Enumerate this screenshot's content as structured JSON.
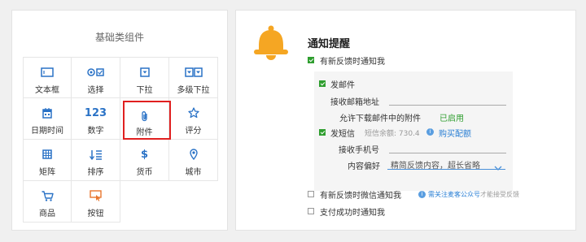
{
  "left": {
    "title": "基础类组件",
    "items": [
      {
        "label": "文本框",
        "icon": "textbox-icon"
      },
      {
        "label": "选择",
        "icon": "select-icon"
      },
      {
        "label": "下拉",
        "icon": "dropdown-icon"
      },
      {
        "label": "多级下拉",
        "icon": "multi-dropdown-icon"
      },
      {
        "label": "日期时间",
        "icon": "calendar-icon"
      },
      {
        "label": "数字",
        "icon": "number-icon",
        "glyph": "123"
      },
      {
        "label": "附件",
        "icon": "paperclip-icon",
        "selected": true
      },
      {
        "label": "评分",
        "icon": "star-icon"
      },
      {
        "label": "矩阵",
        "icon": "matrix-icon"
      },
      {
        "label": "排序",
        "icon": "sort-icon"
      },
      {
        "label": "货币",
        "icon": "currency-icon",
        "glyph": "$"
      },
      {
        "label": "城市",
        "icon": "location-icon"
      },
      {
        "label": "商品",
        "icon": "cart-icon"
      },
      {
        "label": "按钮",
        "icon": "button-cursor-icon"
      }
    ],
    "accent": "#2a72c6",
    "highlight": "#e02020"
  },
  "right": {
    "title": "通知提醒",
    "opt_feedback": "有新反馈时通知我",
    "email": {
      "label": "发邮件",
      "address_label": "接收邮箱地址",
      "allow_label": "允许下载邮件中的附件",
      "allow_status": "已启用"
    },
    "sms": {
      "label": "发短信",
      "balance": "短信余额: 730.4",
      "buy_link": "购买配额",
      "phone_label": "接收手机号",
      "pref_label": "内容偏好",
      "pref_value": "精简反馈内容，超长省略"
    },
    "opt_wechat": "有新反馈时微信通知我",
    "wechat_hint_link": "需关注麦客公众号",
    "wechat_hint_rest": "才能接受反馈",
    "opt_payment": "支付成功时通知我",
    "colors": {
      "green": "#2f9e2f",
      "blue": "#2a7fd4",
      "bell": "#f5a623"
    }
  }
}
